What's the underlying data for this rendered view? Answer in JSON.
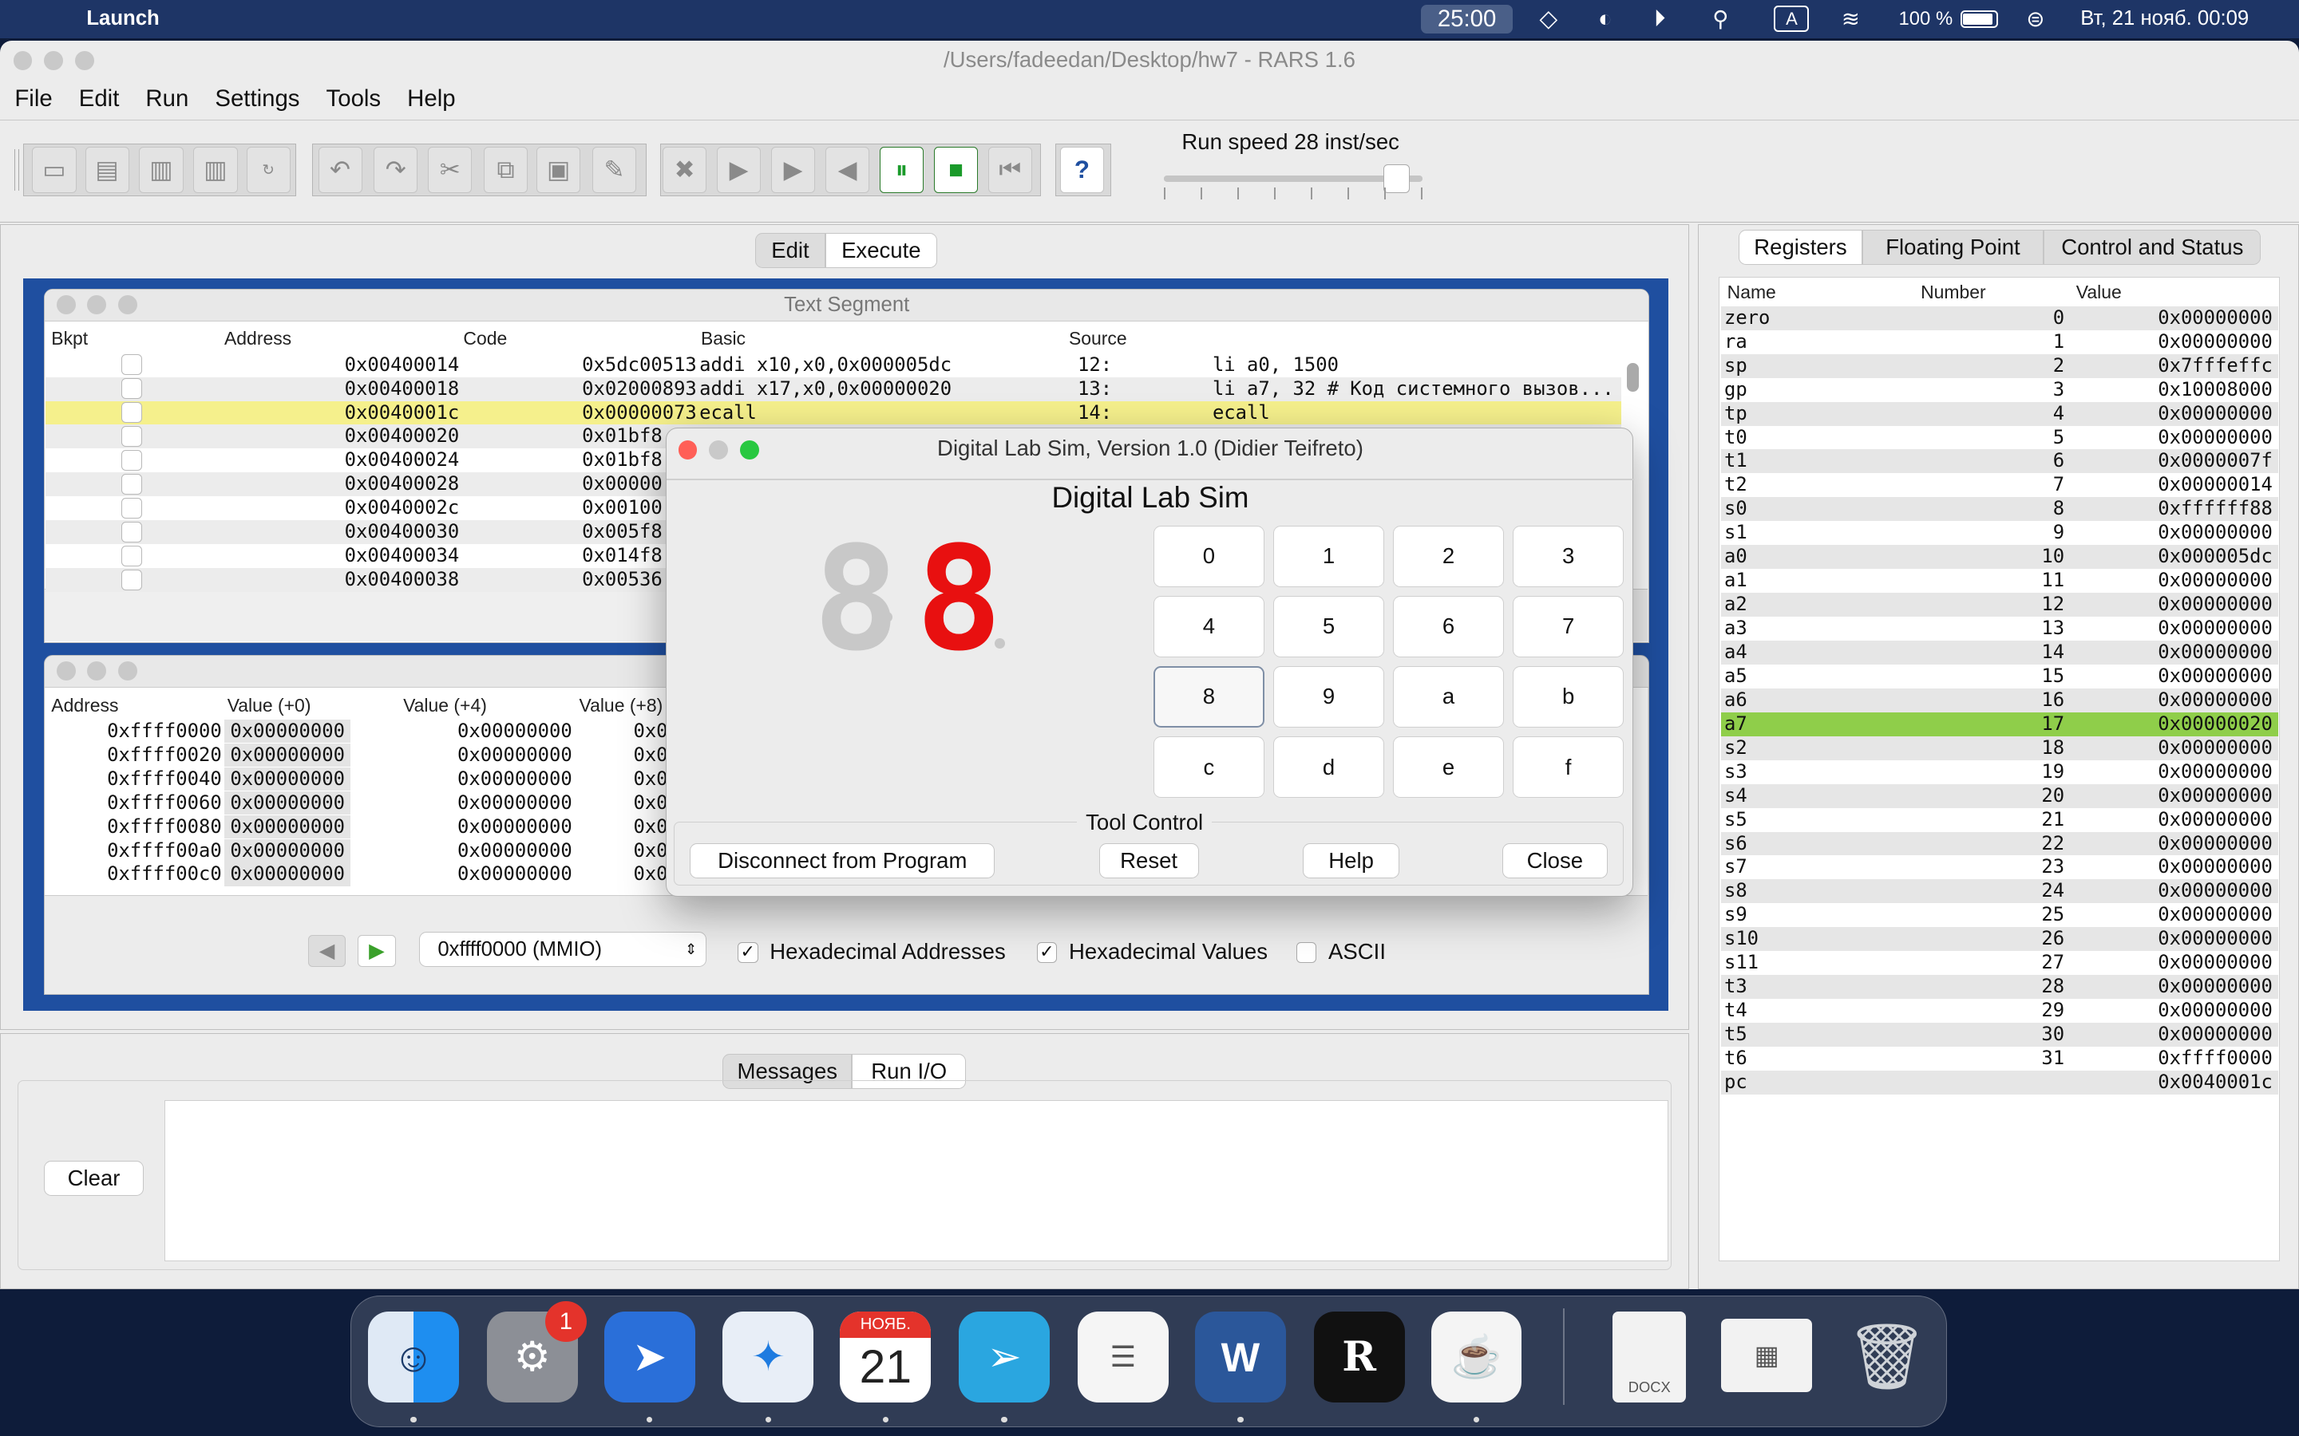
{
  "menubar": {
    "app": "Launch",
    "timer": "25:00",
    "battery": "100 %",
    "datetime": "Вт, 21 нояб.  00:09",
    "input_lang": "A"
  },
  "window": {
    "title": "/Users/fadeedan/Desktop/hw7  - RARS 1.6"
  },
  "app_menu": [
    "File",
    "Edit",
    "Run",
    "Settings",
    "Tools",
    "Help"
  ],
  "toolbar": {
    "run_speed": "Run speed 28 inst/sec",
    "speed_fraction": 0.9
  },
  "main_tabs": [
    "Edit",
    "Execute"
  ],
  "text_segment": {
    "title": "Text Segment",
    "columns": [
      "Bkpt",
      "Address",
      "Code",
      "Basic",
      "Source"
    ],
    "rows": [
      {
        "address": "0x00400014",
        "code": "0x5dc00513",
        "basic": "addi x10,x0,0x000005dc",
        "line": "12:",
        "source": "li a0, 1500"
      },
      {
        "address": "0x00400018",
        "code": "0x02000893",
        "basic": "addi x17,x0,0x00000020",
        "line": "13:",
        "source": "li a7, 32  # Код системного вызов..."
      },
      {
        "address": "0x0040001c",
        "code": "0x00000073",
        "basic": "ecall",
        "line": "14:",
        "source": "ecall"
      },
      {
        "address": "0x00400020",
        "code": "0x01bf8"
      },
      {
        "address": "0x00400024",
        "code": "0x01bf8"
      },
      {
        "address": "0x00400028",
        "code": "0x00000"
      },
      {
        "address": "0x0040002c",
        "code": "0x00100"
      },
      {
        "address": "0x00400030",
        "code": "0x005f8"
      },
      {
        "address": "0x00400034",
        "code": "0x014f8"
      },
      {
        "address": "0x00400038",
        "code": "0x00536"
      }
    ]
  },
  "data_segment": {
    "columns": [
      "Address",
      "Value (+0)",
      "Value (+4)",
      "Value (+8)"
    ],
    "rows": [
      {
        "address": "0xffff0000",
        "v0": "0x00000000",
        "v4": "0x00000000",
        "v8": "0x0"
      },
      {
        "address": "0xffff0020",
        "v0": "0x00000000",
        "v4": "0x00000000",
        "v8": "0x0"
      },
      {
        "address": "0xffff0040",
        "v0": "0x00000000",
        "v4": "0x00000000",
        "v8": "0x0"
      },
      {
        "address": "0xffff0060",
        "v0": "0x00000000",
        "v4": "0x00000000",
        "v8": "0x0"
      },
      {
        "address": "0xffff0080",
        "v0": "0x00000000",
        "v4": "0x00000000",
        "v8": "0x0"
      },
      {
        "address": "0xffff00a0",
        "v0": "0x00000000",
        "v4": "0x00000000",
        "v8": "0x0"
      },
      {
        "address": "0xffff00c0",
        "v0": "0x00000000",
        "v4": "0x00000000",
        "v8": "0x0"
      }
    ],
    "segment_select": "0xffff0000 (MMIO)",
    "hex_addresses": "Hexadecimal Addresses",
    "hex_values": "Hexadecimal Values",
    "ascii": "ASCII"
  },
  "bottom_tabs": [
    "Messages",
    "Run I/O"
  ],
  "clear_label": "Clear",
  "dialog": {
    "title": "Digital Lab Sim,  Version 1.0 (Didier Teifreto)",
    "heading": "Digital Lab Sim",
    "display_left": "8",
    "display_right": "8",
    "keys": [
      "0",
      "1",
      "2",
      "3",
      "4",
      "5",
      "6",
      "7",
      "8",
      "9",
      "a",
      "b",
      "c",
      "d",
      "e",
      "f"
    ],
    "tool_control": "Tool Control",
    "buttons": [
      "Disconnect from Program",
      "Reset",
      "Help",
      "Close"
    ]
  },
  "register_tabs": [
    "Registers",
    "Floating Point",
    "Control and Status"
  ],
  "registers": {
    "columns": [
      "Name",
      "Number",
      "Value"
    ],
    "rows": [
      {
        "name": "zero",
        "num": "0",
        "val": "0x00000000"
      },
      {
        "name": "ra",
        "num": "1",
        "val": "0x00000000"
      },
      {
        "name": "sp",
        "num": "2",
        "val": "0x7fffeffc"
      },
      {
        "name": "gp",
        "num": "3",
        "val": "0x10008000"
      },
      {
        "name": "tp",
        "num": "4",
        "val": "0x00000000"
      },
      {
        "name": "t0",
        "num": "5",
        "val": "0x00000000"
      },
      {
        "name": "t1",
        "num": "6",
        "val": "0x0000007f"
      },
      {
        "name": "t2",
        "num": "7",
        "val": "0x00000014"
      },
      {
        "name": "s0",
        "num": "8",
        "val": "0xffffff88"
      },
      {
        "name": "s1",
        "num": "9",
        "val": "0x00000000"
      },
      {
        "name": "a0",
        "num": "10",
        "val": "0x000005dc"
      },
      {
        "name": "a1",
        "num": "11",
        "val": "0x00000000"
      },
      {
        "name": "a2",
        "num": "12",
        "val": "0x00000000"
      },
      {
        "name": "a3",
        "num": "13",
        "val": "0x00000000"
      },
      {
        "name": "a4",
        "num": "14",
        "val": "0x00000000"
      },
      {
        "name": "a5",
        "num": "15",
        "val": "0x00000000"
      },
      {
        "name": "a6",
        "num": "16",
        "val": "0x00000000"
      },
      {
        "name": "a7",
        "num": "17",
        "val": "0x00000020"
      },
      {
        "name": "s2",
        "num": "18",
        "val": "0x00000000"
      },
      {
        "name": "s3",
        "num": "19",
        "val": "0x00000000"
      },
      {
        "name": "s4",
        "num": "20",
        "val": "0x00000000"
      },
      {
        "name": "s5",
        "num": "21",
        "val": "0x00000000"
      },
      {
        "name": "s6",
        "num": "22",
        "val": "0x00000000"
      },
      {
        "name": "s7",
        "num": "23",
        "val": "0x00000000"
      },
      {
        "name": "s8",
        "num": "24",
        "val": "0x00000000"
      },
      {
        "name": "s9",
        "num": "25",
        "val": "0x00000000"
      },
      {
        "name": "s10",
        "num": "26",
        "val": "0x00000000"
      },
      {
        "name": "s11",
        "num": "27",
        "val": "0x00000000"
      },
      {
        "name": "t3",
        "num": "28",
        "val": "0x00000000"
      },
      {
        "name": "t4",
        "num": "29",
        "val": "0x00000000"
      },
      {
        "name": "t5",
        "num": "30",
        "val": "0x00000000"
      },
      {
        "name": "t6",
        "num": "31",
        "val": "0xffff0000"
      },
      {
        "name": "pc",
        "num": "",
        "val": "0x0040001c"
      }
    ]
  },
  "dock": {
    "calendar_month": "НОЯБ.",
    "calendar_day": "21",
    "settings_badge": "1",
    "docx_label": "DOCX"
  },
  "colors": {
    "highlight_yellow": "#f5f08c",
    "highlight_green": "#8fce4a",
    "segment_red": "#e81010",
    "accent_blue": "#1f4fa0"
  }
}
